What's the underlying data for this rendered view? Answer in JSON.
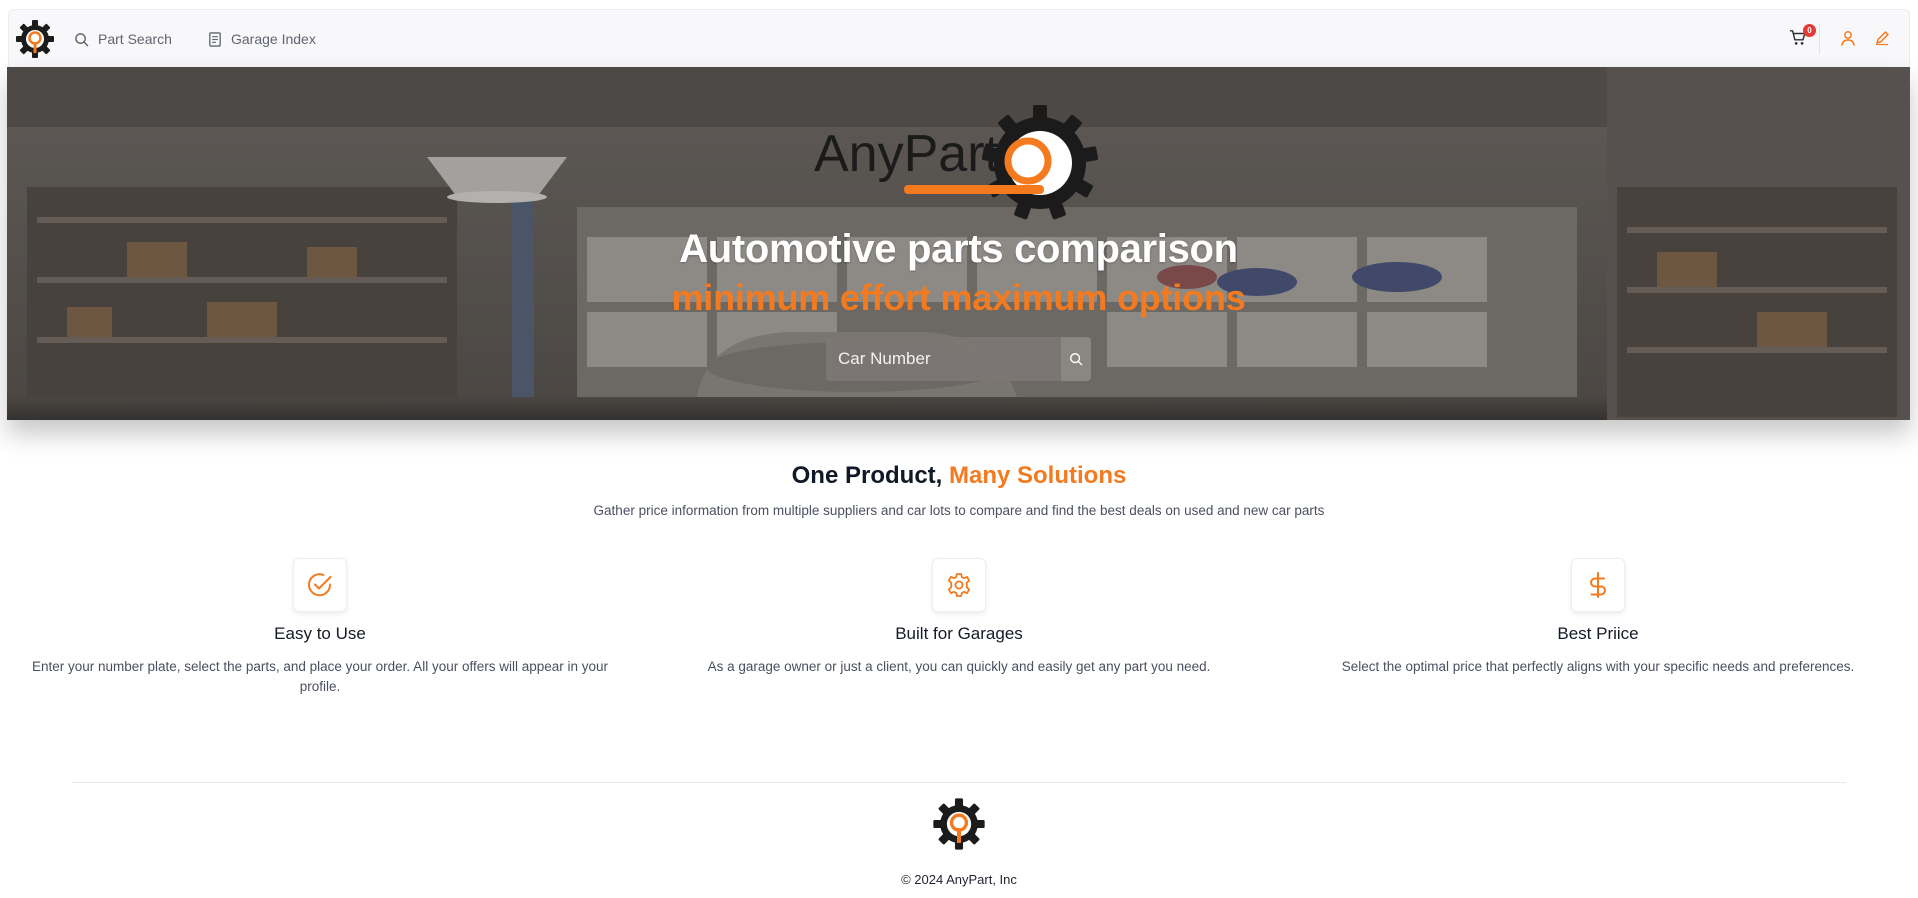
{
  "nav": {
    "links": [
      {
        "label": "Part Search",
        "icon": "search-icon"
      },
      {
        "label": "Garage Index",
        "icon": "document-icon"
      }
    ],
    "cart_count": "0"
  },
  "hero": {
    "brand_text": "AnyPart",
    "title": "Automotive parts comparison",
    "subtitle": "minimum effort maximum options",
    "search_placeholder": "Car Number"
  },
  "features_section": {
    "title_plain": "One Product, ",
    "title_accent": "Many Solutions",
    "description": "Gather price information from multiple suppliers and car lots to compare and find the best deals on used and new car parts",
    "items": [
      {
        "icon": "check-circle-icon",
        "title": "Easy to Use",
        "text": "Enter your number plate, select the parts, and place your order. All your offers will appear in your profile."
      },
      {
        "icon": "gear-icon",
        "title": "Built for Garages",
        "text": "As a garage owner or just a client, you can quickly and easily get any part you need."
      },
      {
        "icon": "dollar-icon",
        "title": "Best Priice",
        "text": "Select the optimal price that perfectly aligns with your specific needs and preferences."
      }
    ]
  },
  "footer": {
    "copyright": "© 2024 AnyPart, Inc"
  },
  "colors": {
    "accent": "#f47a1f",
    "dark": "#1b1b1b",
    "badge": "#e53935"
  }
}
